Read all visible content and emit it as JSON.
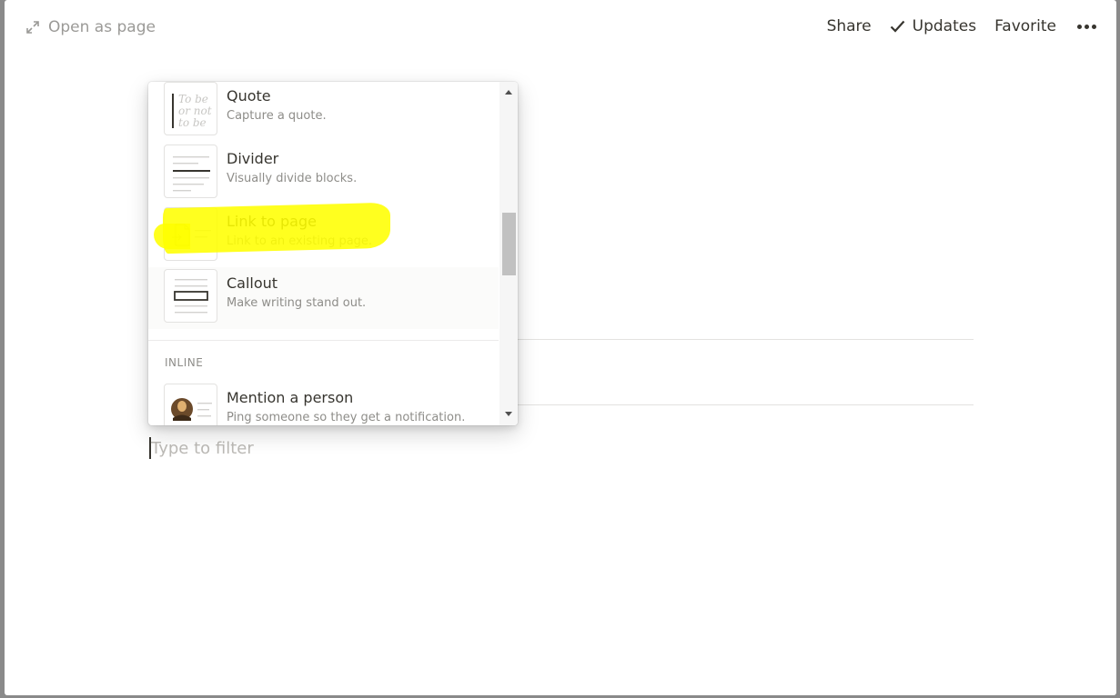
{
  "header": {
    "open_as_page": "Open as page",
    "share": "Share",
    "updates": "Updates",
    "favorite": "Favorite"
  },
  "menu": {
    "items": [
      {
        "label": "Quote",
        "description": "Capture a quote.",
        "icon": "quote-thumbnail",
        "thumb_text": [
          "To be",
          "or not",
          "to be"
        ]
      },
      {
        "label": "Divider",
        "description": "Visually divide blocks.",
        "icon": "divider-thumbnail"
      },
      {
        "label": "Link to page",
        "description": "Link to an existing page.",
        "icon": "link-to-page-thumbnail",
        "highlighted": true
      },
      {
        "label": "Callout",
        "description": "Make writing stand out.",
        "icon": "callout-thumbnail"
      }
    ],
    "section_inline": "INLINE",
    "inline_items": [
      {
        "label": "Mention a person",
        "description": "Ping someone so they get a notification.",
        "icon": "mention-person-thumbnail"
      }
    ]
  },
  "filter": {
    "placeholder": "Type to filter"
  },
  "colors": {
    "highlight": "#ffff00",
    "text": "#37352f",
    "muted": "#8e8d89"
  }
}
